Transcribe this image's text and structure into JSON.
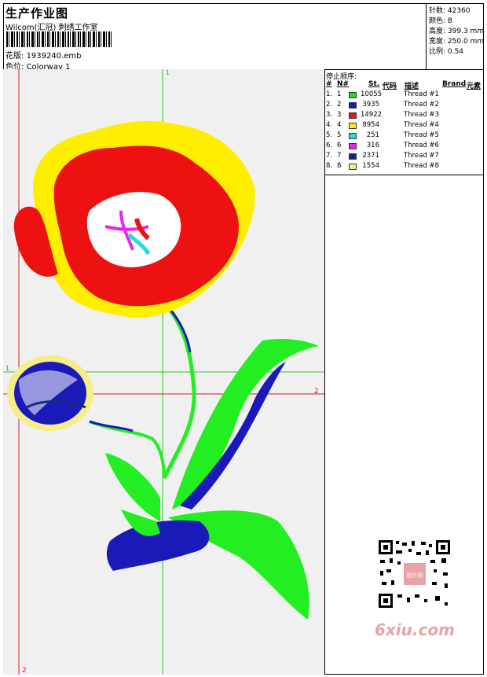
{
  "header": {
    "title": "生产作业图",
    "studio": "Wilcom(汇冠) 刺绣工作室",
    "design_label": "花版:",
    "design_file": "1939240.emb",
    "colorway_label": "色位:",
    "colorway": "Colorway 1"
  },
  "stats": {
    "stitches_label": "针数:",
    "stitches": "42360",
    "colors_label": "颜色:",
    "colors": "8",
    "height_label": "高度:",
    "height": "399.3 mm",
    "width_label": "宽度:",
    "width": "250.0 mm",
    "scale_label": "比例:",
    "scale": "0.54"
  },
  "sequence": {
    "title": "停止顺序:",
    "headers": {
      "num": "#",
      "no": "N#",
      "st": "St.",
      "code": "代码",
      "desc": "描述",
      "brand": "Brand",
      "element": "元素"
    },
    "rows": [
      {
        "num": "1.",
        "no": "1",
        "color": "#22dd22",
        "stitches": "10055",
        "desc": "Thread #1"
      },
      {
        "num": "2.",
        "no": "2",
        "color": "#1a1ab8",
        "stitches": "3935",
        "desc": "Thread #2"
      },
      {
        "num": "3.",
        "no": "3",
        "color": "#ee1111",
        "stitches": "14922",
        "desc": "Thread #3"
      },
      {
        "num": "4.",
        "no": "4",
        "color": "#ffee00",
        "stitches": "8954",
        "desc": "Thread #4"
      },
      {
        "num": "5.",
        "no": "5",
        "color": "#22dddd",
        "stitches": "251",
        "desc": "Thread #5"
      },
      {
        "num": "6.",
        "no": "6",
        "color": "#ee22ee",
        "stitches": "316",
        "desc": "Thread #6"
      },
      {
        "num": "7.",
        "no": "7",
        "color": "#1a2a7a",
        "stitches": "2371",
        "desc": "Thread #7"
      },
      {
        "num": "8.",
        "no": "8",
        "color": "#f5ec8a",
        "stitches": "1554",
        "desc": "Thread #8"
      }
    ]
  },
  "guides": {
    "v1": "1",
    "h1": "1",
    "h2": "2",
    "v2": "2",
    "green": "#22cc22",
    "red": "#cc2222"
  },
  "watermark": {
    "qr_text": "图片网",
    "brand": "6xiu.com"
  }
}
